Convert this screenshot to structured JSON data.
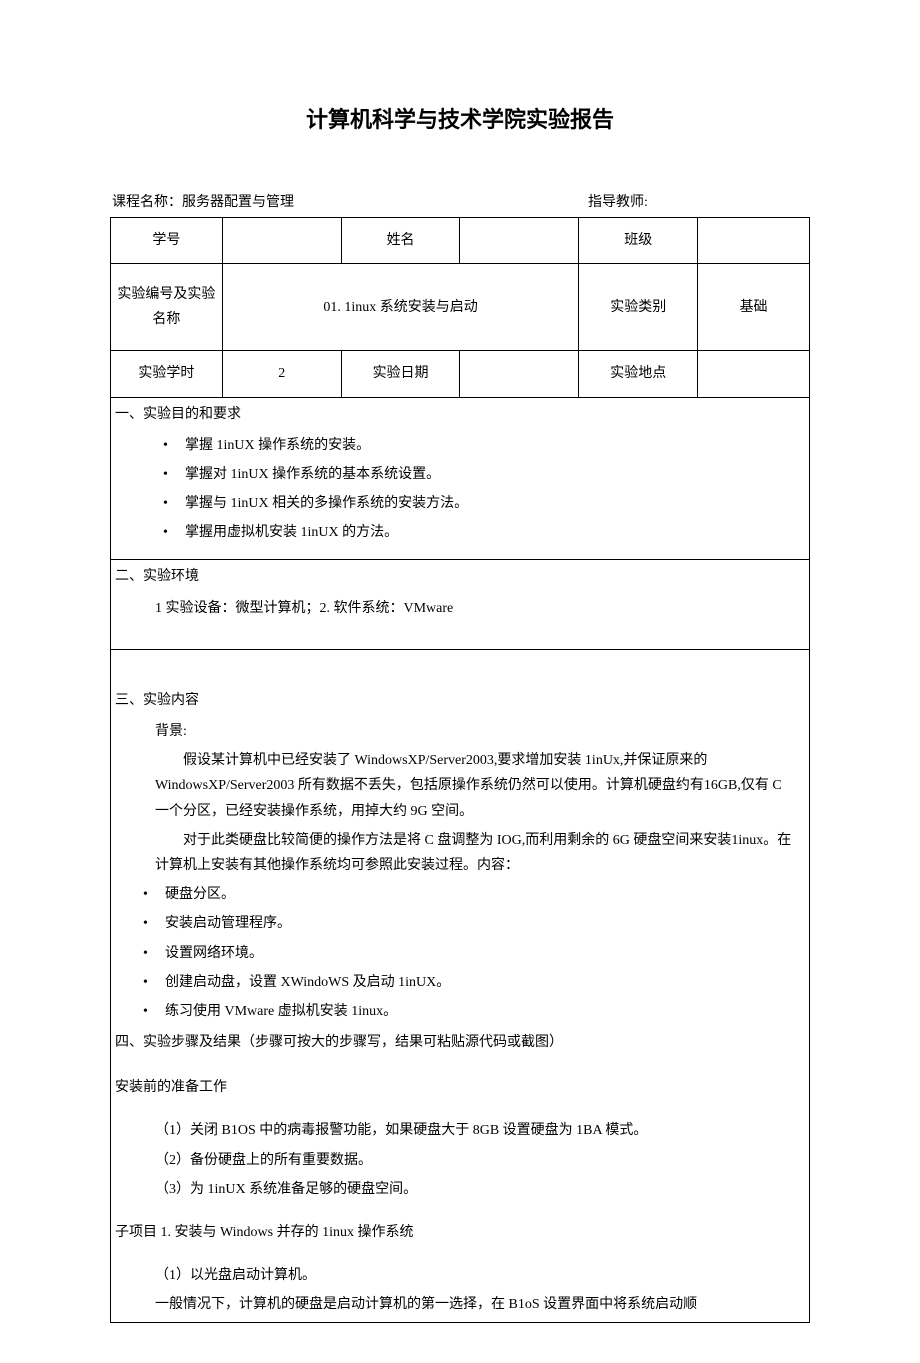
{
  "page_title": "计算机科学与技术学院实验报告",
  "course_label": "课程名称：",
  "course_name": "服务器配置与管理",
  "instructor_label": "指导教师:",
  "instructor_name": "",
  "table": {
    "student_id_label": "学号",
    "student_id": "",
    "name_label": "姓名",
    "name": "",
    "class_label": "班级",
    "class": "",
    "exp_no_name_label": "实验编号及实验名称",
    "exp_no_name": "01. 1inux 系统安装与启动",
    "exp_type_label": "实验类别",
    "exp_type": "基础",
    "hours_label": "实验学时",
    "hours": "2",
    "date_label": "实验日期",
    "date": "",
    "place_label": "实验地点",
    "place": ""
  },
  "sec1": {
    "title": "一、实验目的和要求",
    "items": [
      "掌握 1inUX 操作系统的安装。",
      "掌握对 1inUX 操作系统的基本系统设置。",
      "掌握与 1inUX 相关的多操作系统的安装方法。",
      "掌握用虚拟机安装 1inUX 的方法。"
    ]
  },
  "sec2": {
    "title": "二、实验环境",
    "body": "1 实验设备：微型计算机；2. 软件系统：VMware"
  },
  "sec3": {
    "title": "三、实验内容",
    "bg_label": "背景:",
    "p1": "假设某计算机中已经安装了 WindowsXP/Server2003,要求增加安装 1inUx,并保证原来的WindowsXP/Server2003 所有数据不丢失，包括原操作系统仍然可以使用。计算机硬盘约有16GB,仅有 C 一个分区，已经安装操作系统，用掉大约 9G 空间。",
    "p2": "对于此类硬盘比较简便的操作方法是将 C 盘调整为 IOG,而利用剩余的 6G 硬盘空间来安装1inux。在计算机上安装有其他操作系统均可参照此安装过程。内容：",
    "items": [
      "硬盘分区。",
      "安装启动管理程序。",
      "设置网络环境。",
      "创建启动盘，设置 XWindoWS 及启动 1inUX。",
      "练习使用 VMware 虚拟机安装 1inux。"
    ]
  },
  "sec4": {
    "title": "四、实验步骤及结果（步骤可按大的步骤写，结果可粘贴源代码或截图）",
    "prep_title": "安装前的准备工作",
    "prep_items": [
      "（1）关闭 B1OS 中的病毒报警功能，如果硬盘大于 8GB 设置硬盘为 1BA 模式。",
      "（2）备份硬盘上的所有重要数据。",
      "（3）为 1inUX 系统准备足够的硬盘空间。"
    ],
    "sub1_title": "子项目 1. 安装与 Windows 并存的 1inux 操作系统",
    "sub1_item1": "（1）以光盘启动计算机。",
    "sub1_p": "一般情况下，计算机的硬盘是启动计算机的第一选择，在 B1oS 设置界面中将系统启动顺"
  }
}
